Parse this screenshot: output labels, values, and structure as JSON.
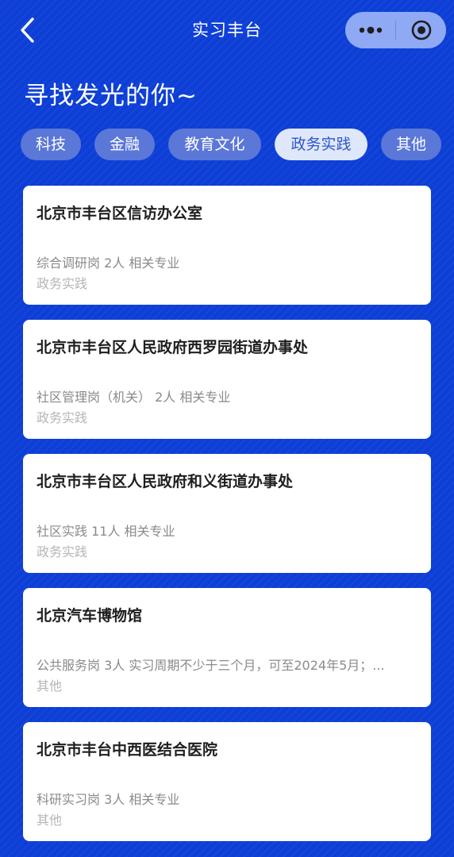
{
  "nav": {
    "title": "实习丰台",
    "back_icon": "chevron-left-icon",
    "more_icon": "more-dots-icon",
    "close_icon": "target-circle-icon"
  },
  "heading": "寻找发光的你~",
  "tabs": [
    {
      "label": "科技",
      "active": false
    },
    {
      "label": "金融",
      "active": false
    },
    {
      "label": "教育文化",
      "active": false
    },
    {
      "label": "政务实践",
      "active": true
    },
    {
      "label": "其他",
      "active": false
    }
  ],
  "listings": [
    {
      "org": "北京市丰台区信访办公室",
      "detail": "综合调研岗 2人 相关专业",
      "category": "政务实践"
    },
    {
      "org": "北京市丰台区人民政府西罗园街道办事处",
      "detail": "社区管理岗（机关） 2人 相关专业",
      "category": "政务实践"
    },
    {
      "org": "北京市丰台区人民政府和义街道办事处",
      "detail": "社区实践 11人 相关专业",
      "category": "政务实践"
    },
    {
      "org": "北京汽车博物馆",
      "detail": "公共服务岗 3人 实习周期不少于三个月，可至2024年5月；...",
      "category": "其他"
    },
    {
      "org": "北京市丰台中西医结合医院",
      "detail": "科研实习岗 3人 相关专业",
      "category": "其他"
    }
  ],
  "colors": {
    "background": "#0d3fd6",
    "tab_bg": "#5b78d8",
    "tab_active_bg": "#dfe8fb",
    "tab_active_text": "#2f56c9"
  }
}
